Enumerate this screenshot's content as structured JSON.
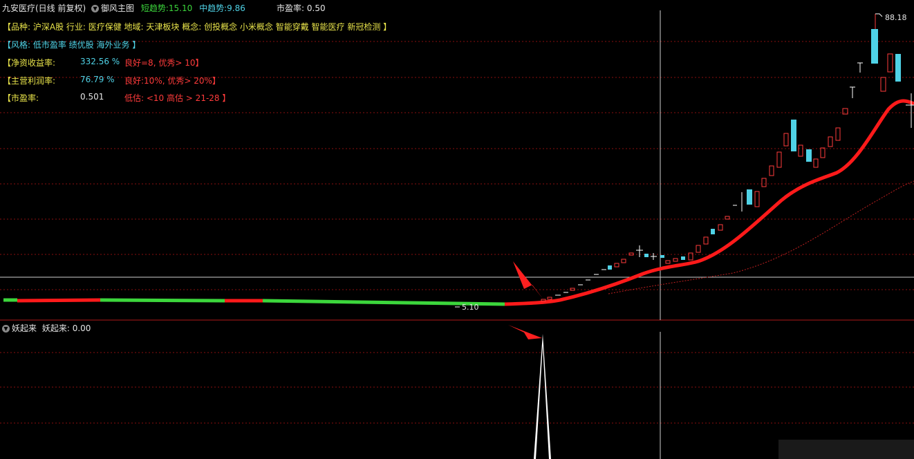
{
  "header": {
    "stock_title": "九安医疗(日线 前复权)",
    "indicator_name": "御风主图",
    "short_trend_label": "短趋势:",
    "short_trend_value": "15.10",
    "mid_trend_label": "中趋势:",
    "mid_trend_value": "9.86",
    "pe_label": "市盈率:",
    "pe_value": "0.50"
  },
  "info": {
    "category_line": "【品种: 沪深A股   行业: 医疗保健   地域: 天津板块   概念: 创投概念 小米概念 智能穿戴 智能医疗 新冠检测 】",
    "style_line": "【风格: 低市盈率 绩优股 海外业务 】",
    "roe": {
      "label": "【净资收益率:",
      "value": "332.56 %",
      "note": "良好=8, 优秀> 10】"
    },
    "margin": {
      "label": "【主营利润率:",
      "value": "76.79 %",
      "note": "良好:10%, 优秀> 20%】"
    },
    "pe": {
      "label": "【市盈率:",
      "value": "0.501",
      "note": "低估: <10 高估 > 21-28 】"
    }
  },
  "annotations": {
    "high_price": "88.18",
    "low_price": "5.10"
  },
  "sub_panel": {
    "title": "妖起来",
    "label": "妖起来:",
    "value": "0.00"
  },
  "colors": {
    "up": "#ff3b3b",
    "down": "#4fd2e6",
    "trend_red": "#ff1a1a",
    "trend_green": "#3cd63c",
    "grid": "#8b1010"
  }
}
